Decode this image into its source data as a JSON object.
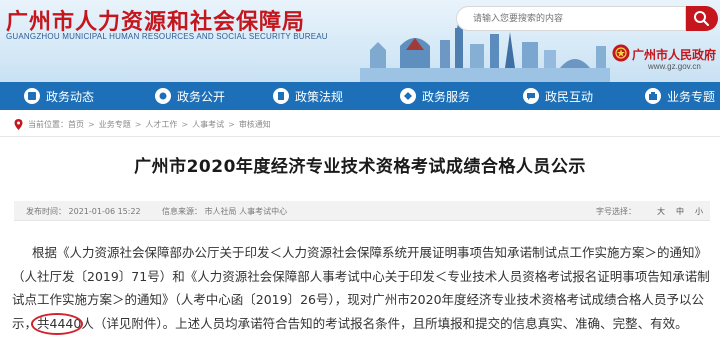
{
  "header": {
    "title": "广州市人力资源和社会保障局",
    "subtitle": "GUANGZHOU MUNICIPAL HUMAN RESOURCES AND SOCIAL SECURITY BUREAU",
    "search_placeholder": "请输入您要搜索的内容",
    "gov_name": "广州市人民政府",
    "gov_url": "www.gz.gov.cn",
    "brand_color": "#c4161c",
    "nav_color": "#1d70b8"
  },
  "nav": {
    "items": [
      {
        "label": "政务动态",
        "icon": "news-icon"
      },
      {
        "label": "政务公开",
        "icon": "publicity-icon"
      },
      {
        "label": "政策法规",
        "icon": "policy-icon"
      },
      {
        "label": "政务服务",
        "icon": "service-icon"
      },
      {
        "label": "政民互动",
        "icon": "interaction-icon"
      },
      {
        "label": "业务专题",
        "icon": "topic-icon"
      }
    ]
  },
  "breadcrumb": {
    "prefix": "当前位置：",
    "items": [
      "首页",
      "业务专题",
      "人才工作",
      "人事考试",
      "审核通知"
    ]
  },
  "article": {
    "title": "广州市2020年度经济专业技术资格考试成绩合格人员公示",
    "published": "发布时间： 2021-01-06 15:22",
    "source": "信息来源：  市人社局 人事考试中心",
    "font_size_label": "字号选择：",
    "font_sizes": [
      "大",
      "中",
      "小"
    ],
    "lines": [
      "根据《人力资源社会保障部办公厅关于印发＜人力资源社会保障系统开展证明事项告知承诺制试点工作实施方案＞的通知》",
      "（人社厅发〔2019〕71号）和《人力资源社会保障部人事考试中心关于印发＜专业技术人员资格考试报名证明事项告知承诺制",
      "试点工作实施方案＞的通知》（人考中心函〔2019〕26号），现对广州市2020年度经济专业技术资格考试成绩合格人员予以公",
      "示，"
    ],
    "count_prefix": "共",
    "count": "4440",
    "count_unit": "人",
    "line4_rest": "（详见附件）。上述人员均承诺符合告知的考试报名条件，且所填报和提交的信息真实、准确、完整、有效。"
  }
}
